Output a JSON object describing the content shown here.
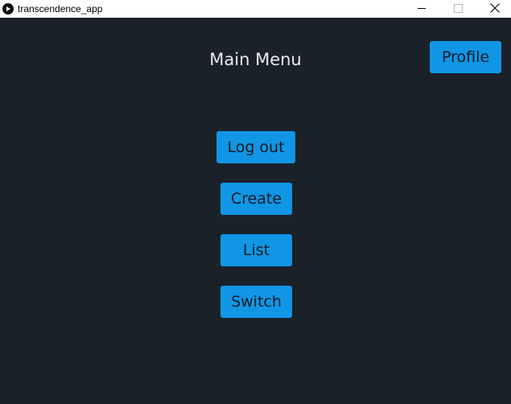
{
  "window": {
    "title": "transcendence_app",
    "app_icon": "play-circle-icon",
    "controls": [
      "minimize-icon",
      "maximize-icon",
      "close-icon"
    ]
  },
  "main_menu": {
    "title": "Main Menu",
    "profile_label": "Profile",
    "buttons": {
      "logout": "Log out",
      "create": "Create",
      "list": "List",
      "switch": "Switch"
    }
  },
  "colors": {
    "background": "#1a2129",
    "button": "#1196e5",
    "button_text": "#0e1a24",
    "title_text": "#e8ecef"
  }
}
